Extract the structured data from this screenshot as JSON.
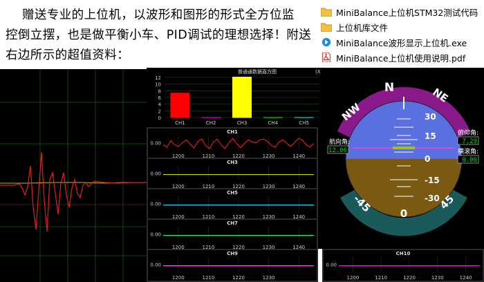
{
  "promo": {
    "line1": "赠送专业的上位机，以波形和图形的形式全方位监",
    "line2": "控倒立摆，也是做平衡小车、PID调试的理想选择！附送",
    "line3": "右边所示的超值资料："
  },
  "files": [
    {
      "name": "MiniBalance上位机STM32测试代码",
      "icon": "folder-icon"
    },
    {
      "name": "上位机库文件",
      "icon": "folder-icon"
    },
    {
      "name": "MiniBalance波形显示上位机.exe",
      "icon": "exe-icon"
    },
    {
      "name": "MiniBalance上位机使用说明.pdf",
      "icon": "pdf-icon"
    }
  ],
  "bar_panel": {
    "title": "普通通数据直方图",
    "title_suffix": "(X"
  },
  "chart_data": [
    {
      "type": "bar",
      "title": "普通通数据直方图",
      "categories": [
        "CH1",
        "CH2",
        "CH3",
        "CH4",
        "CH5"
      ],
      "values": [
        7.4,
        0,
        12.2,
        0,
        0
      ],
      "colors": [
        "#ff0000",
        "#ff00ff",
        "#ffff00",
        "#00ff00",
        "#00ffff"
      ],
      "ylim": [
        0,
        12
      ],
      "yticks": [
        "0",
        "2",
        "4",
        "6",
        "8",
        "10",
        "12"
      ]
    },
    {
      "type": "line",
      "title": "CH1",
      "color": "#ff2020",
      "ytick": "0.00",
      "xticks": [
        "1200",
        "1210",
        "1220",
        "1230",
        "1240"
      ],
      "y": [
        0.35,
        0.2,
        0.65,
        0.35,
        0.25,
        0.5,
        0.7,
        0.4,
        0.15,
        0.6,
        0.75,
        0.3,
        0.1,
        0.55,
        0.75,
        0.35,
        0.1,
        0.5,
        0.8,
        0.45,
        0.15,
        0.45,
        0.7,
        0.55,
        0.5,
        0.7,
        0.75,
        0.6,
        0.3,
        0.2,
        0.55,
        0.7,
        0.45,
        0.25,
        0.5,
        0.8,
        0.7,
        0.35,
        0.2,
        0.45
      ]
    },
    {
      "type": "line",
      "title": "CH3",
      "color": "#e0e000",
      "ytick": "0.00",
      "xticks": [
        "1200",
        "1210",
        "1220",
        "1230",
        "1240"
      ]
    },
    {
      "type": "line",
      "title": "CH5",
      "color": "#00e0ff",
      "ytick": "0.00",
      "xticks": [
        "1200",
        "1210",
        "1220",
        "1230",
        "1240"
      ]
    },
    {
      "type": "line",
      "title": "CH7",
      "color": "#00ff66",
      "ytick": "0.00",
      "xticks": [
        "1200",
        "1210",
        "1220",
        "1230",
        "1240"
      ]
    },
    {
      "type": "line",
      "title": "CH9",
      "color": "#ff66ff",
      "ytick": "0.00",
      "xticks": [
        "1200",
        "1210",
        "1220",
        "1230"
      ]
    },
    {
      "type": "line",
      "title": "CH10",
      "color": "#d040d0",
      "ytick": "0.00",
      "xticks": [
        "1200",
        "1210",
        "1220",
        "1230",
        "1240"
      ]
    }
  ],
  "attitude": {
    "compass_labels": [
      "NW",
      "N",
      "NE"
    ],
    "pitch_labels": [
      "30",
      "15",
      "0",
      "-15",
      "-30"
    ],
    "roll_labels": [
      "-45",
      "0",
      "45"
    ],
    "heading_label": "航向角:",
    "heading_value": "12.06",
    "pitch_label": "俯仰角:",
    "pitch_value": "7.29",
    "roll_label": "横滚角:",
    "roll_value": "0.00",
    "colors": {
      "sky": "#5a6fe0",
      "ground": "#7a5a12",
      "compass": "#8a1a8a",
      "roll_ring": "#1a5a5a"
    }
  }
}
